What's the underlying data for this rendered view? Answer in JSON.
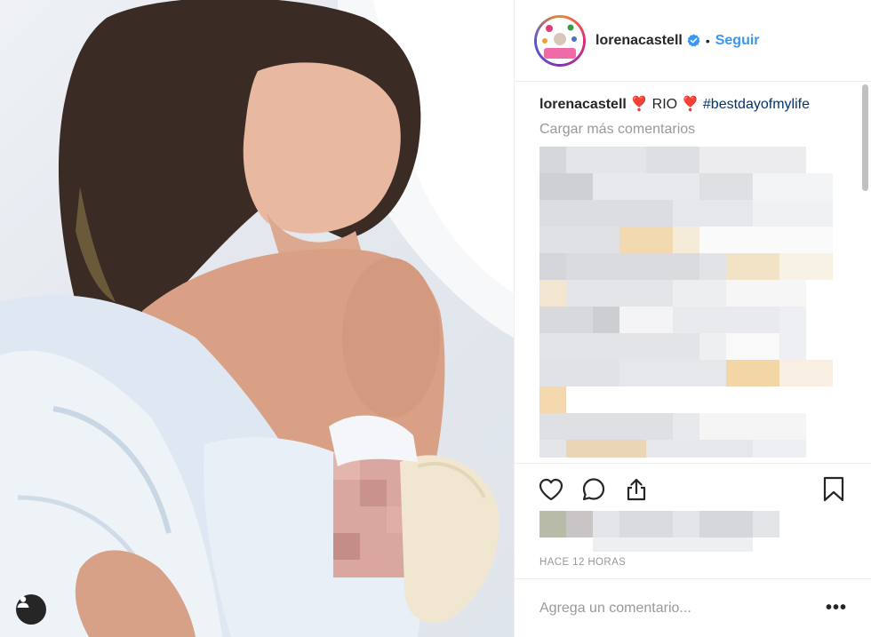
{
  "post": {
    "username": "lorenacastell",
    "follow_label": "Seguir",
    "separator": "•"
  },
  "caption": {
    "username": "lorenacastell",
    "text": " ❣️ RIO ❣️ ",
    "hashtag": "#bestdayofmylife"
  },
  "comments": {
    "load_more": "Cargar más comentarios"
  },
  "meta": {
    "timestamp": "HACE 12 HORAS"
  },
  "composer": {
    "placeholder": "Agrega un comentario...",
    "more_label": "•••"
  },
  "colors": {
    "link_blue": "#3897f0",
    "hashtag_blue": "#003569",
    "muted_gray": "#999999",
    "text": "#262626",
    "verified_blue": "#3897f0"
  },
  "icons": [
    "heart-icon",
    "comment-icon",
    "share-icon",
    "bookmark-icon",
    "user-tag-icon",
    "verified-badge-icon"
  ]
}
